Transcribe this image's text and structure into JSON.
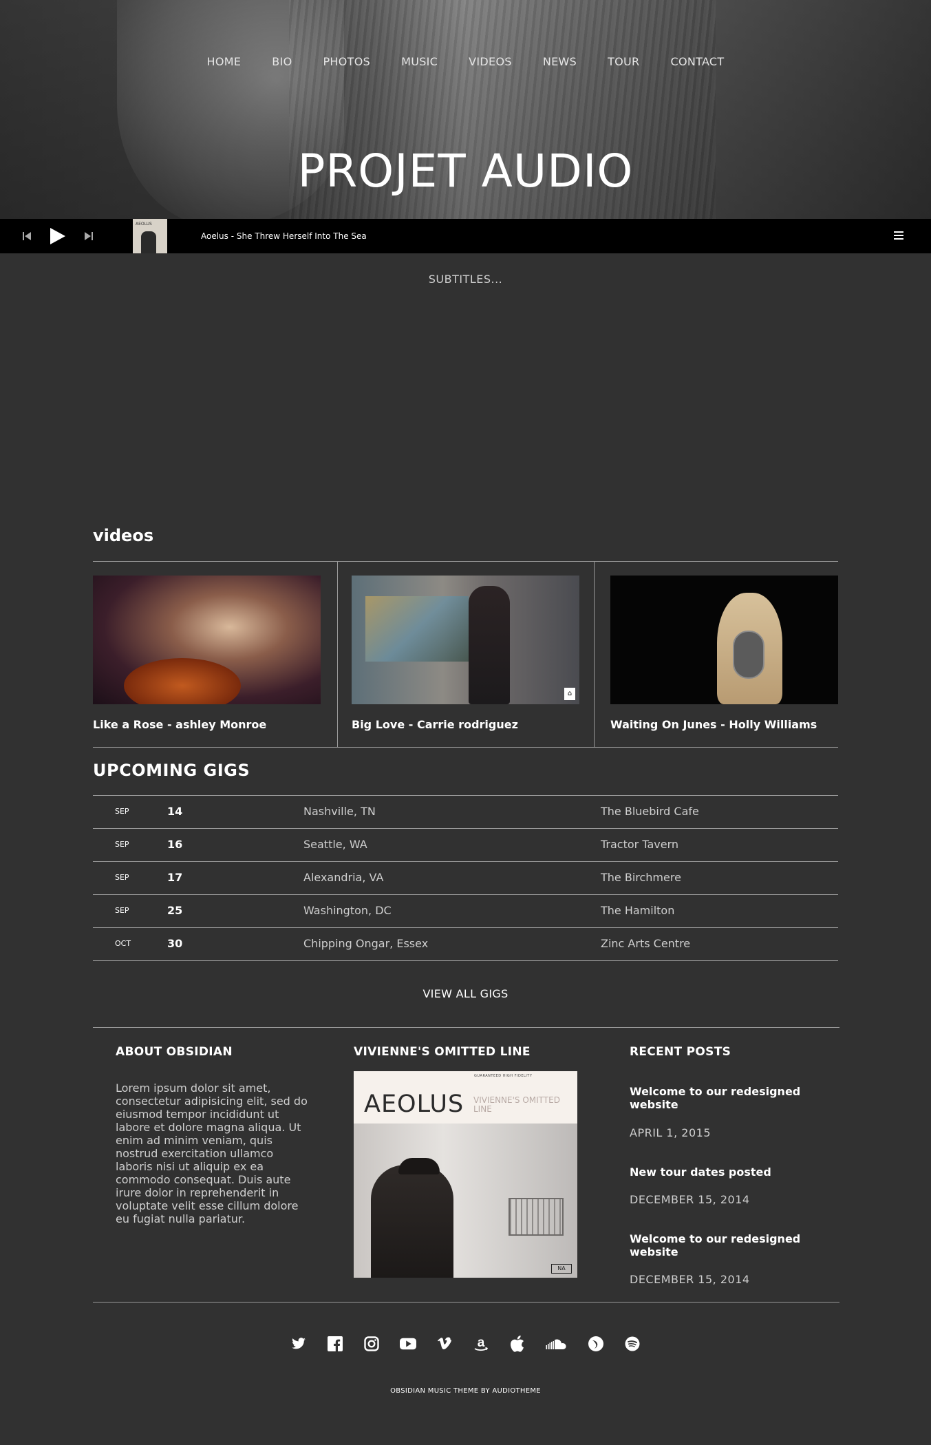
{
  "nav": [
    "HOME",
    "BIO",
    "PHOTOS",
    "MUSIC",
    "VIDEOS",
    "NEWS",
    "TOUR",
    "CONTACT"
  ],
  "site_title": "PROJET AUDIO",
  "player": {
    "track": "Aoelus - She Threw Herself Into The Sea",
    "thumb_text": "AEOLUS"
  },
  "subtitles": "SUBTITLES...",
  "videos": {
    "title": "videos",
    "items": [
      {
        "caption": "Like a Rose - ashley Monroe"
      },
      {
        "caption": "Big Love - Carrie rodriguez"
      },
      {
        "caption": "Waiting On Junes - Holly Williams"
      }
    ]
  },
  "gigs": {
    "title": "UPCOMING GIGS",
    "rows": [
      {
        "month": "SEP",
        "day": "14",
        "city": "Nashville, TN",
        "venue": "The Bluebird Cafe"
      },
      {
        "month": "SEP",
        "day": "16",
        "city": "Seattle, WA",
        "venue": "Tractor Tavern"
      },
      {
        "month": "SEP",
        "day": "17",
        "city": "Alexandria, VA",
        "venue": "The Birchmere"
      },
      {
        "month": "SEP",
        "day": "25",
        "city": "Washington, DC",
        "venue": "The Hamilton"
      },
      {
        "month": "OCT",
        "day": "30",
        "city": "Chipping Ongar, Essex",
        "venue": "Zinc Arts Centre"
      }
    ],
    "view_all": "VIEW ALL GIGS"
  },
  "footer": {
    "about_title": "ABOUT OBSIDIAN",
    "about_text": "Lorem ipsum dolor sit amet, consectetur adipisicing elit, sed do eiusmod tempor incididunt ut labore et dolore magna aliqua. Ut enim ad minim veniam, quis nostrud exercitation ullamco laboris nisi ut aliquip ex ea commodo consequat. Duis aute irure dolor in reprehenderit in voluptate velit esse cillum dolore eu fugiat nulla pariatur.",
    "album_title": "VIVIENNE'S OMITTED LINE",
    "album_cover": {
      "top": "GUARANTEED HIGH FIDELITY",
      "name": "AEOLUS",
      "sub": "VIVIENNE'S OMITTED LINE"
    },
    "recent_title": "RECENT POSTS",
    "posts": [
      {
        "title": "Welcome to our redesigned website",
        "date": "APRIL 1, 2015"
      },
      {
        "title": "New tour dates posted",
        "date": "DECEMBER 15, 2014"
      },
      {
        "title": "Welcome to our redesigned website",
        "date": "DECEMBER 15, 2014"
      }
    ]
  },
  "social": [
    "twitter-icon",
    "facebook-icon",
    "instagram-icon",
    "youtube-icon",
    "vimeo-icon",
    "amazon-icon",
    "apple-icon",
    "soundcloud-icon",
    "bandcamp-icon",
    "spotify-icon"
  ],
  "credit": "OBSIDIAN MUSIC THEME BY AUDIOTHEME",
  "colors": {
    "background": "#313131",
    "player_bar": "#000000",
    "text": "#ffffff",
    "muted": "#cfcfcf",
    "rule": "#9a9a9a"
  }
}
